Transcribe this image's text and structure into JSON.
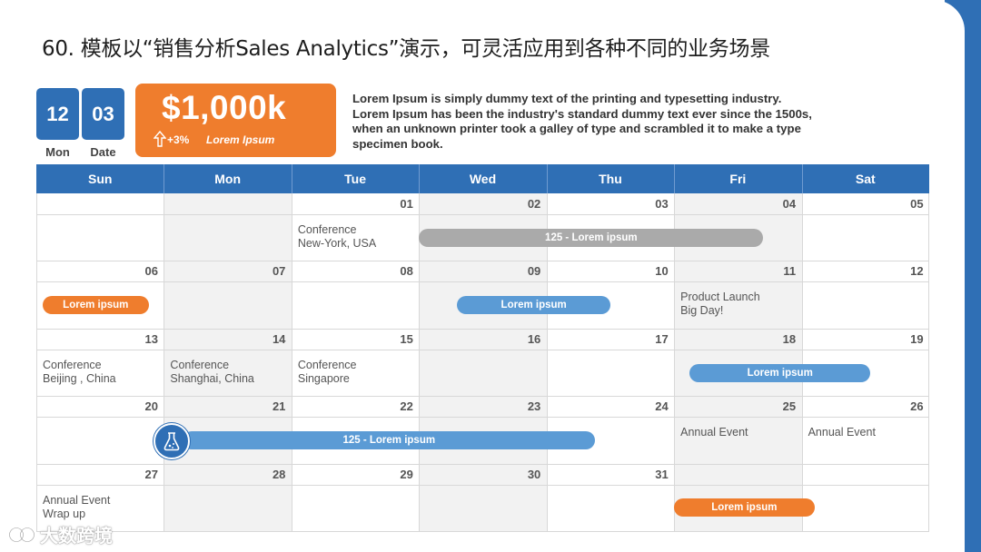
{
  "title": "60. 模板以“销售分析Sales Analytics”演示，可灵活应用到各种不同的业务场景",
  "date_boxes": [
    {
      "value": "12",
      "label": "Mon"
    },
    {
      "value": "03",
      "label": "Date"
    }
  ],
  "kpi": {
    "value": "$1,000k",
    "change": "+3%",
    "note": "Lorem Ipsum"
  },
  "description_lines": [
    "Lorem Ipsum is simply dummy text of the printing and typesetting industry.",
    "Lorem Ipsum has been the industry's standard dummy text ever since the 1500s,",
    "when an unknown printer took a galley of type and scrambled it to make a type",
    "specimen book."
  ],
  "calendar": {
    "days": [
      "Sun",
      "Mon",
      "Tue",
      "Wed",
      "Thu",
      "Fri",
      "Sat"
    ],
    "weeks": [
      [
        "",
        "",
        "01",
        "02",
        "03",
        "04",
        "05"
      ],
      [
        "06",
        "07",
        "08",
        "09",
        "10",
        "11",
        "12"
      ],
      [
        "13",
        "14",
        "15",
        "16",
        "17",
        "18",
        "19"
      ],
      [
        "20",
        "21",
        "22",
        "23",
        "24",
        "25",
        "26"
      ],
      [
        "27",
        "28",
        "29",
        "30",
        "31",
        "",
        ""
      ]
    ],
    "text_events": [
      {
        "week": 0,
        "col": 2,
        "lines": [
          "Conference",
          "New-York, USA"
        ]
      },
      {
        "week": 1,
        "col": 5,
        "lines": [
          "Product Launch",
          "Big Day!"
        ]
      },
      {
        "week": 2,
        "col": 0,
        "lines": [
          "Conference",
          "Beijing , China"
        ]
      },
      {
        "week": 2,
        "col": 1,
        "lines": [
          "Conference",
          "Shanghai, China"
        ]
      },
      {
        "week": 2,
        "col": 2,
        "lines": [
          "Conference",
          "Singapore"
        ]
      },
      {
        "week": 3,
        "col": 5,
        "lines": [
          "Annual Event"
        ]
      },
      {
        "week": 3,
        "col": 6,
        "lines": [
          "Annual Event"
        ]
      },
      {
        "week": 4,
        "col": 0,
        "lines": [
          "Annual Event",
          "Wrap up"
        ]
      }
    ],
    "bar_events": [
      {
        "week": 0,
        "start": 3.0,
        "end": 5.7,
        "label": "125 - Lorem ipsum",
        "color": "gray"
      },
      {
        "week": 1,
        "start": 0.05,
        "end": 0.88,
        "label": "Lorem ipsum",
        "color": "orange"
      },
      {
        "week": 1,
        "start": 3.3,
        "end": 4.5,
        "label": "Lorem ipsum",
        "color": "blue"
      },
      {
        "week": 2,
        "start": 5.12,
        "end": 6.54,
        "label": "Lorem ipsum",
        "color": "blue"
      },
      {
        "week": 3,
        "start": 1.15,
        "end": 4.38,
        "label": "125 - Lorem ipsum",
        "color": "blue",
        "icon": "flask-icon"
      },
      {
        "week": 4,
        "start": 5.0,
        "end": 6.1,
        "label": "Lorem ipsum",
        "color": "orange"
      }
    ]
  },
  "watermark": "大数跨境"
}
